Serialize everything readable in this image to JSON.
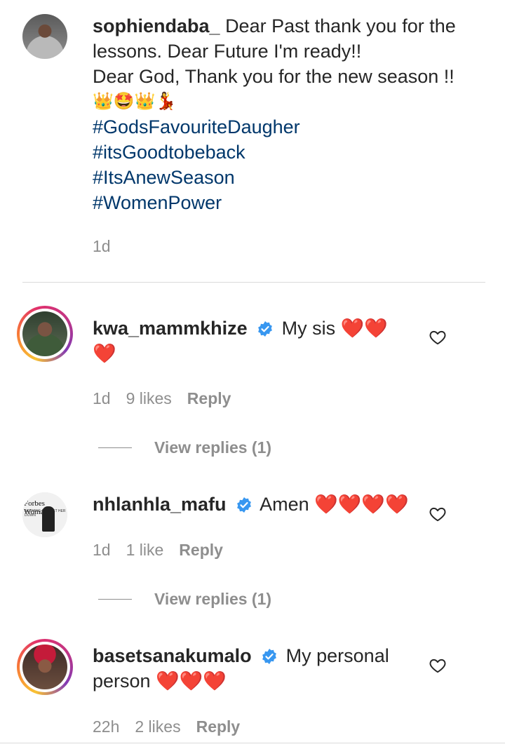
{
  "caption": {
    "username": "sophiendaba_",
    "lines": [
      "Dear Past thank you for the",
      "lessons. Dear Future I'm ready!!",
      "Dear God, Thank you for the new season !!"
    ],
    "emojis": "👑🤩👑💃",
    "hashtags": [
      "#GodsFavouriteDaugher",
      "#itsGoodtobeback",
      "#ItsAnewSeason",
      "#WomenPower"
    ],
    "time": "1d"
  },
  "comments": [
    {
      "username": "kwa_mammkhize",
      "text_line1": "My sis ❤️❤️",
      "text_line2": "❤️",
      "time": "1d",
      "likes": "9 likes",
      "reply": "Reply",
      "view_replies": "View replies (1)"
    },
    {
      "username": "nhlanhla_mafu",
      "text_line1": "Amen ❤️❤️❤️❤️",
      "time": "1d",
      "likes": "1 like",
      "reply": "Reply",
      "view_replies": "View replies (1)",
      "avatar_text": "Forbes Woman",
      "avatar_small_text": "NOTHING CAN GET HER DOWN"
    },
    {
      "username": "basetsanakumalo",
      "text_line1": "My personal",
      "text_line2": "person ❤️❤️❤️",
      "time": "22h",
      "likes": "2 likes",
      "reply": "Reply"
    }
  ],
  "colors": {
    "hashtag": "#00376b",
    "meta_gray": "#8e8e8e",
    "verified_blue": "#3897f0",
    "heart_red": "#e0102b"
  },
  "icons": {
    "verified": "verified-badge-icon",
    "like": "heart-outline-icon"
  }
}
